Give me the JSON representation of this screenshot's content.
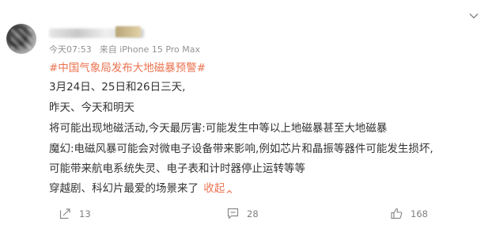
{
  "post": {
    "meta": {
      "time": "今天07:53",
      "device": "来自 iPhone 15 Pro Max"
    },
    "hashtag": "#中国气象局发布大地磁暴预警#",
    "lines": [
      "3月24日、25日和26日三天,",
      "昨天、今天和明天",
      "将可能出现地磁活动,今天最厉害:可能发生中等以上地磁暴甚至大地磁暴",
      "魔幻:电磁风暴可能会对微电子设备带来影响,例如芯片和晶振等器件可能发生损坏,",
      "可能带来航电系统失灵、电子表和计时器停止运转等等",
      "穿越剧、科幻片最爱的场景来了"
    ],
    "collapse_label": "收起"
  },
  "actions": {
    "share_count": "13",
    "comment_count": "28",
    "like_count": "168"
  },
  "icons": {
    "menu": "chevron-down-icon",
    "share": "share-icon",
    "comment": "comment-icon",
    "like": "thumbs-up-icon"
  },
  "colors": {
    "accent": "#eb7350",
    "text": "#333333",
    "muted": "#939393"
  }
}
